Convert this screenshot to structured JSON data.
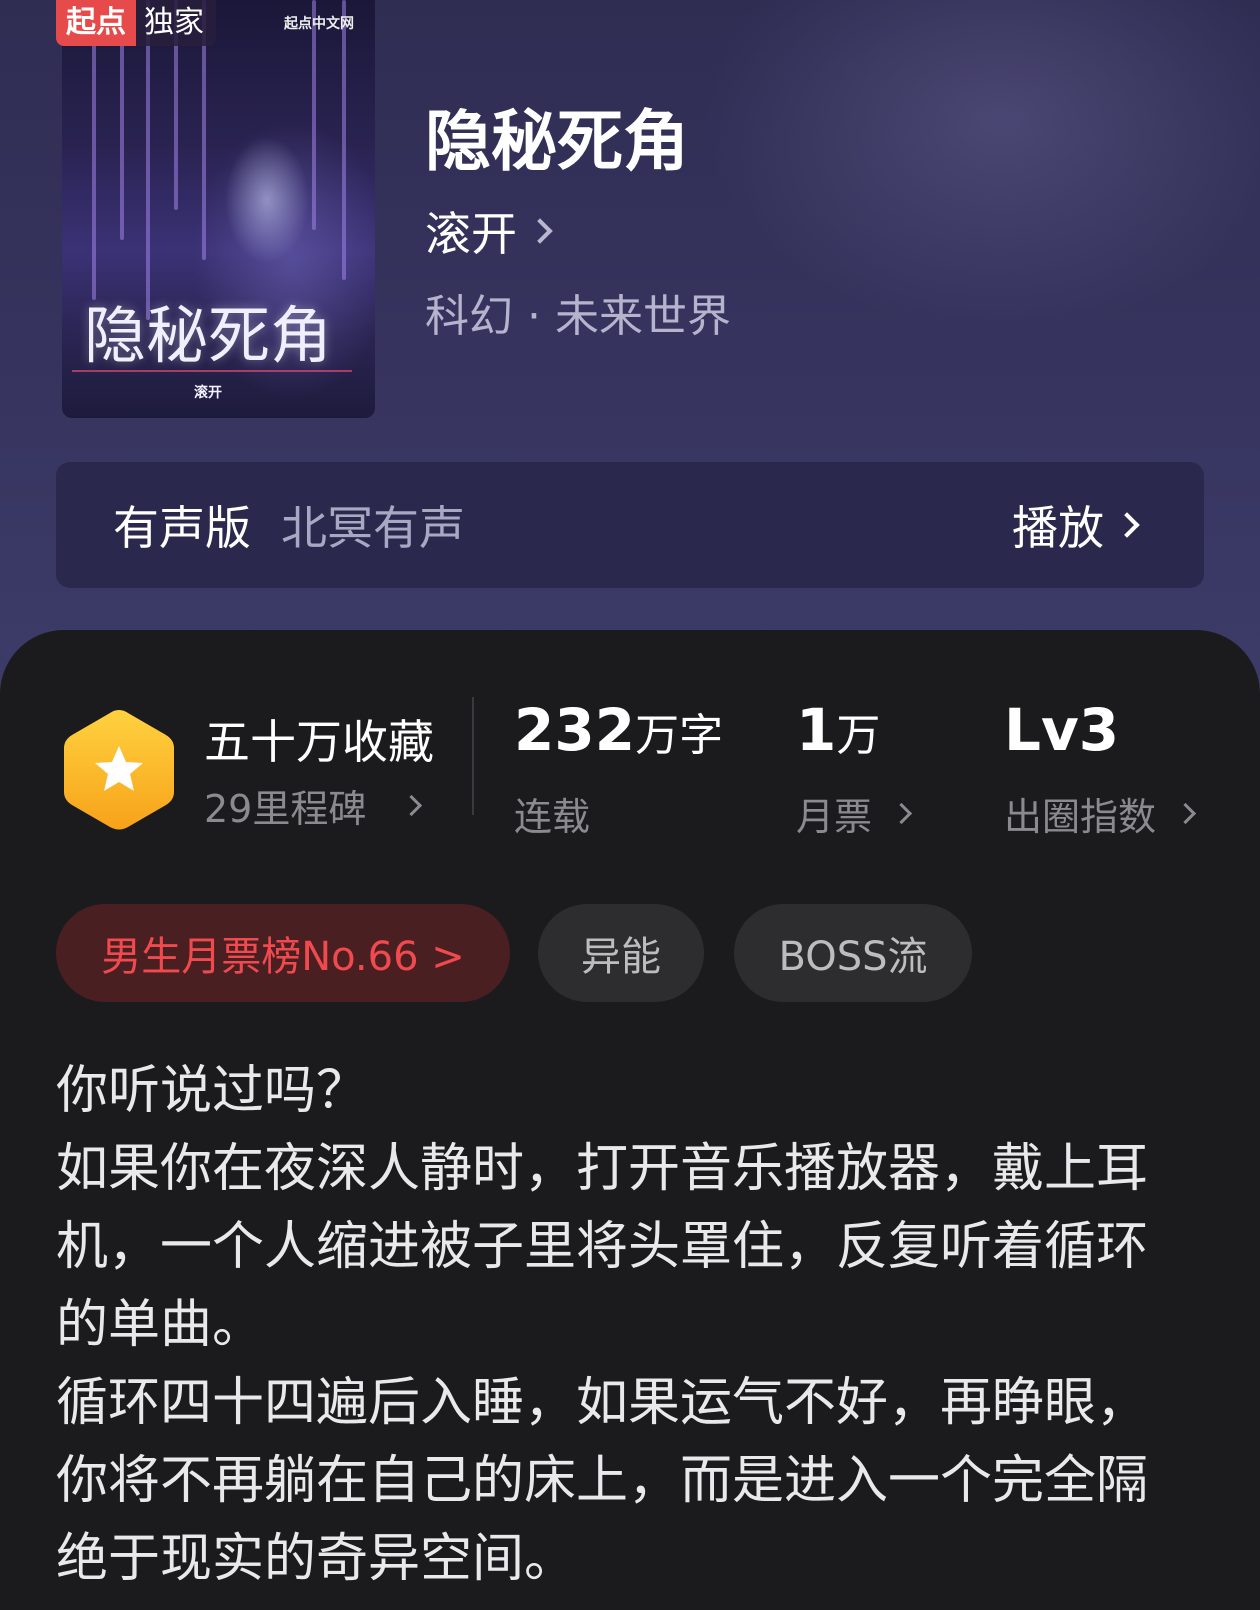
{
  "badge": {
    "brand": "起点",
    "exclusive": "独家"
  },
  "cover": {
    "site": "起点中文网",
    "title": "隐秘死角",
    "author": "滚开"
  },
  "book": {
    "title": "隐秘死角",
    "author": "滚开",
    "genre": "科幻 · 未来世界"
  },
  "audio": {
    "label": "有声版",
    "narrator": "北冥有声",
    "play_label": "播放"
  },
  "stats": {
    "collect": {
      "value": "五十万收藏",
      "sub": "29里程碑",
      "icon": "star-hex-icon",
      "icon_color": "#f7b21f"
    },
    "words": {
      "value": "232",
      "unit": "万字",
      "sub": "连载"
    },
    "tickets": {
      "value": "1",
      "unit": "万",
      "sub": "月票"
    },
    "influence": {
      "value": "Lv3",
      "sub": "出圈指数"
    }
  },
  "tags": [
    {
      "label": "男生月票榜No.66 >",
      "kind": "rank",
      "color": "#f0494e"
    },
    {
      "label": "异能",
      "kind": "plain"
    },
    {
      "label": "BOSS流",
      "kind": "plain"
    }
  ],
  "synopsis": [
    "你听说过吗？",
    "如果你在夜深人静时，打开音乐播放器，戴上耳机，一个人缩进被子里将头罩住，反复听着循环的单曲。",
    "循环四十四遍后入睡，如果运气不好，再睁眼，你将不再躺在自己的床上，而是进入一个完全隔绝于现实的奇异空间。"
  ]
}
